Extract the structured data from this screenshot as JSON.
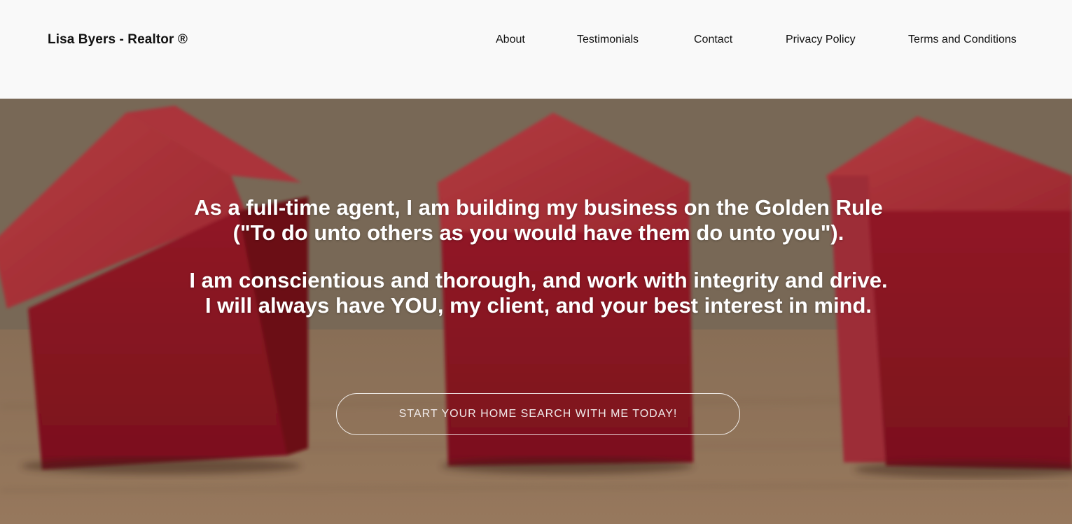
{
  "header": {
    "brand": "Lisa Byers - Realtor ®",
    "nav": [
      {
        "label": "About"
      },
      {
        "label": "Testimonials"
      },
      {
        "label": "Contact"
      },
      {
        "label": "Privacy Policy"
      },
      {
        "label": "Terms and Conditions"
      }
    ]
  },
  "hero": {
    "paragraph_1": [
      "As a full-time agent, I am building my business on the Golden Rule",
      "(\"To do unto others as you would have them do unto you\")."
    ],
    "paragraph_2": [
      "I am conscientious and thorough, and work with integrity and drive.",
      "I will always have YOU, my client, and your best interest in mind."
    ],
    "cta_label": "START YOUR HOME SEARCH WITH ME TODAY!",
    "background_image": "red wooden toy houses on a wooden table"
  },
  "colors": {
    "header_bg": "#f9f9f9",
    "text_dark": "#111111",
    "hero_text": "#ffffff",
    "house_red": "#c0302f"
  }
}
